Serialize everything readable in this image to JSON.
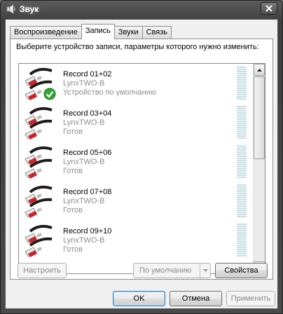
{
  "window": {
    "title": "Звук"
  },
  "tabs": [
    {
      "label": "Воспроизведение",
      "active": false
    },
    {
      "label": "Запись",
      "active": true
    },
    {
      "label": "Звуки",
      "active": false
    },
    {
      "label": "Связь",
      "active": false
    }
  ],
  "panel": {
    "instruction": "Выберите устройство записи, параметры которого нужно изменить:"
  },
  "devices": [
    {
      "name": "Record 01+02",
      "driver": "LynxTWO-B",
      "status": "Устройство по умолчанию",
      "is_default": true
    },
    {
      "name": "Record 03+04",
      "driver": "LynxTWO-B",
      "status": "Готов",
      "is_default": false
    },
    {
      "name": "Record 05+06",
      "driver": "LynxTWO-B",
      "status": "Готов",
      "is_default": false
    },
    {
      "name": "Record 07+08",
      "driver": "LynxTWO-B",
      "status": "Готов",
      "is_default": false
    },
    {
      "name": "Record 09+10",
      "driver": "LynxTWO-B",
      "status": "Готов",
      "is_default": false
    }
  ],
  "panel_buttons": {
    "configure": "Настроить",
    "set_default": "По умолчанию",
    "properties": "Свойства"
  },
  "dialog_buttons": {
    "ok": "OK",
    "cancel": "Отмена",
    "apply": "Применить"
  },
  "colors": {
    "meter": "#c6dfe6",
    "check": "#2fa82f",
    "plug_red": "#c8262b",
    "cable": "#1d1d1d"
  }
}
